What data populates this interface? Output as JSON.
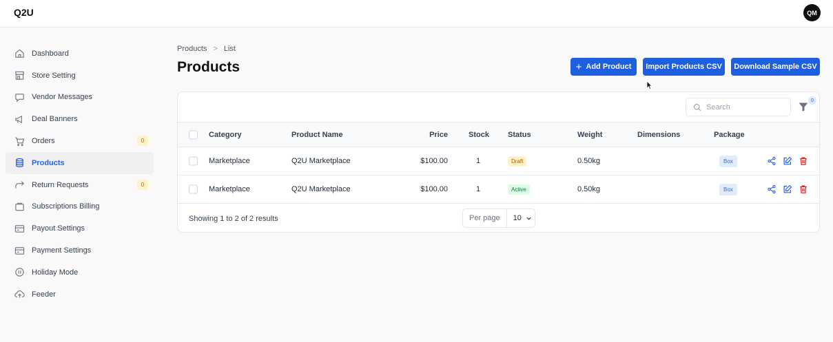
{
  "app": {
    "logo": "Q2U",
    "avatar_initials": "QM"
  },
  "sidebar": {
    "items": [
      {
        "label": "Dashboard",
        "icon": "home-icon"
      },
      {
        "label": "Store Setting",
        "icon": "store-icon"
      },
      {
        "label": "Vendor Messages",
        "icon": "message-icon"
      },
      {
        "label": "Deal Banners",
        "icon": "megaphone-icon"
      },
      {
        "label": "Orders",
        "icon": "cart-icon",
        "badge": "0"
      },
      {
        "label": "Products",
        "icon": "database-icon",
        "active": true
      },
      {
        "label": "Return Requests",
        "icon": "return-arrow-icon",
        "badge": "0"
      },
      {
        "label": "Subscriptions Billing",
        "icon": "billing-icon"
      },
      {
        "label": "Payout Settings",
        "icon": "card-icon"
      },
      {
        "label": "Payment Settings",
        "icon": "card-icon"
      },
      {
        "label": "Holiday Mode",
        "icon": "pause-icon"
      },
      {
        "label": "Feeder",
        "icon": "upload-cloud-icon"
      }
    ]
  },
  "breadcrumb": {
    "parent": "Products",
    "separator": ">",
    "current": "List"
  },
  "page": {
    "title": "Products"
  },
  "toolbar": {
    "add_label": "Add Product",
    "import_label": "Import Products CSV",
    "download_label": "Download Sample CSV"
  },
  "search": {
    "placeholder": "Search",
    "value": ""
  },
  "filter": {
    "badge": "0"
  },
  "table": {
    "columns": [
      "Category",
      "Product Name",
      "Price",
      "Stock",
      "Status",
      "Weight",
      "Dimensions",
      "Package"
    ],
    "rows": [
      {
        "category": "Marketplace",
        "name": "Q2U Marketplace",
        "price": "$100.00",
        "stock": "1",
        "status": "Draft",
        "weight": "0.50kg",
        "dimensions": "",
        "package": "Box"
      },
      {
        "category": "Marketplace",
        "name": "Q2U Marketplace",
        "price": "$100.00",
        "stock": "1",
        "status": "Active",
        "weight": "0.50kg",
        "dimensions": "",
        "package": "Box"
      }
    ]
  },
  "pagination": {
    "summary": "Showing 1 to 2 of 2 results",
    "per_page_label": "Per page",
    "per_page_value": "10"
  },
  "colors": {
    "primary": "#1d5fdf",
    "active_nav": "#2563eb",
    "delete": "#dc2626",
    "draft": "#b45309",
    "active_status": "#15803d"
  }
}
